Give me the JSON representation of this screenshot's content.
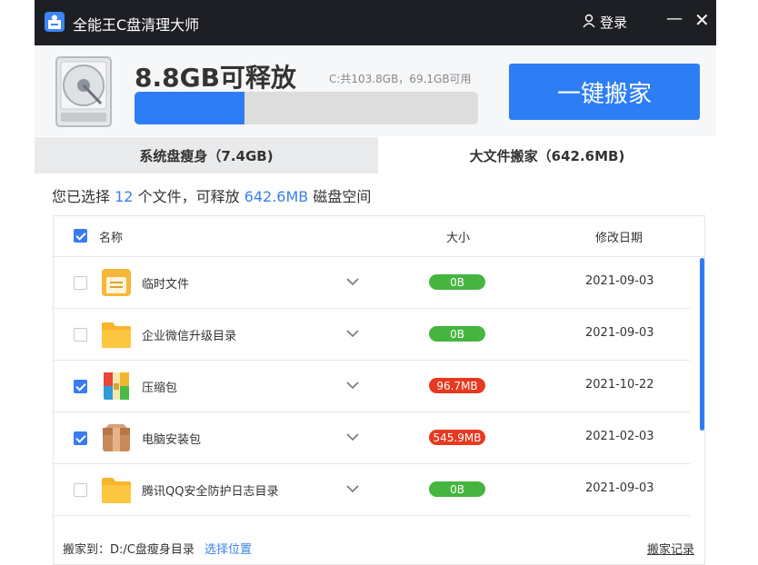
{
  "app": {
    "title": "全能王C盘清理大师"
  },
  "titlebar": {
    "login_label": "登录",
    "minimize_glyph": "—",
    "close_glyph": "✕"
  },
  "header": {
    "free_text": "8.8GB可释放",
    "disk_info": "C:共103.8GB，69.1GB可用",
    "used_fraction": 0.32,
    "move_button": "一键搬家"
  },
  "tabs": [
    {
      "label": "系统盘瘦身（7.4GB)",
      "active": false
    },
    {
      "label": "大文件搬家（642.6MB)",
      "active": true
    }
  ],
  "summary": {
    "prefix": "您已选择",
    "count": "12",
    "middle": "个文件，可释放",
    "size": "642.6MB",
    "suffix": "磁盘空间"
  },
  "table": {
    "header_checked": true,
    "columns": {
      "name": "名称",
      "size": "大小",
      "date": "修改日期"
    },
    "rows": [
      {
        "name": "临时文件",
        "size": "0B",
        "size_color": "#45b53f",
        "date": "2021-09-03",
        "checked": false,
        "icon": "notes-folder-icon"
      },
      {
        "name": "企业微信升级目录",
        "size": "0B",
        "size_color": "#45b53f",
        "date": "2021-09-03",
        "checked": false,
        "icon": "folder-icon"
      },
      {
        "name": "压缩包",
        "size": "96.7MB",
        "size_color": "#e6391f",
        "date": "2021-10-22",
        "checked": true,
        "icon": "archive-icon"
      },
      {
        "name": "电脑安装包",
        "size": "545.9MB",
        "size_color": "#e6391f",
        "date": "2021-02-03",
        "checked": true,
        "icon": "package-icon"
      },
      {
        "name": "腾讯QQ安全防护日志目录",
        "size": "0B",
        "size_color": "#45b53f",
        "date": "2021-09-03",
        "checked": false,
        "icon": "folder-icon"
      }
    ]
  },
  "footer": {
    "destination": "搬家到：D:/C盘瘦身目录",
    "choose_label": "选择位置",
    "history_label": "搬家记录"
  },
  "colors": {
    "accent": "#2d7df4",
    "green": "#45b53f",
    "red": "#e6391f",
    "titlebar": "#1e1f24"
  }
}
